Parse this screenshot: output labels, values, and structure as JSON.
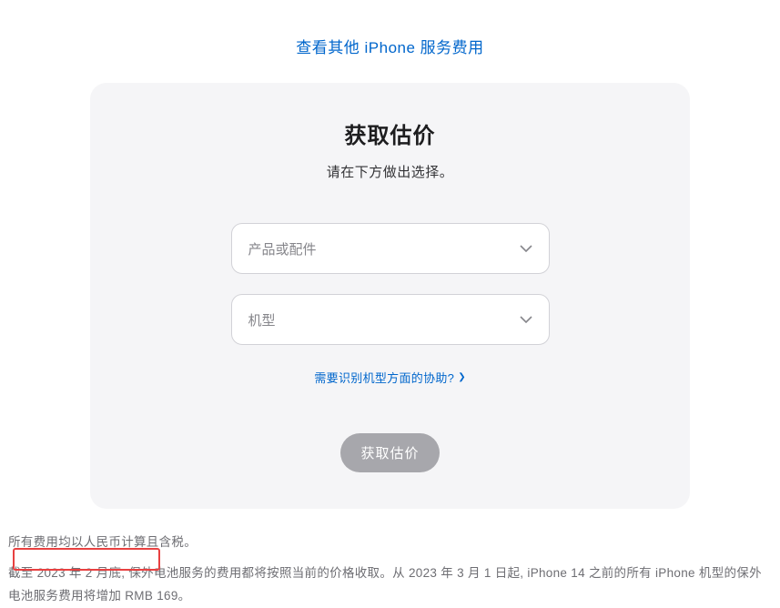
{
  "topLink": {
    "text": "查看其他 iPhone 服务费用"
  },
  "card": {
    "title": "获取估价",
    "subtitle": "请在下方做出选择。",
    "select1": {
      "placeholder": "产品或配件"
    },
    "select2": {
      "placeholder": "机型"
    },
    "helpLink": "需要识别机型方面的协助?",
    "submitLabel": "获取估价"
  },
  "footer": {
    "line1": "所有费用均以人民币计算且含税。",
    "line2": "截至 2023 年 2 月底, 保外电池服务的费用都将按照当前的价格收取。从 2023 年 3 月 1 日起, iPhone 14 之前的所有 iPhone 机型的保外电池服务费用将增加 RMB 169。"
  }
}
